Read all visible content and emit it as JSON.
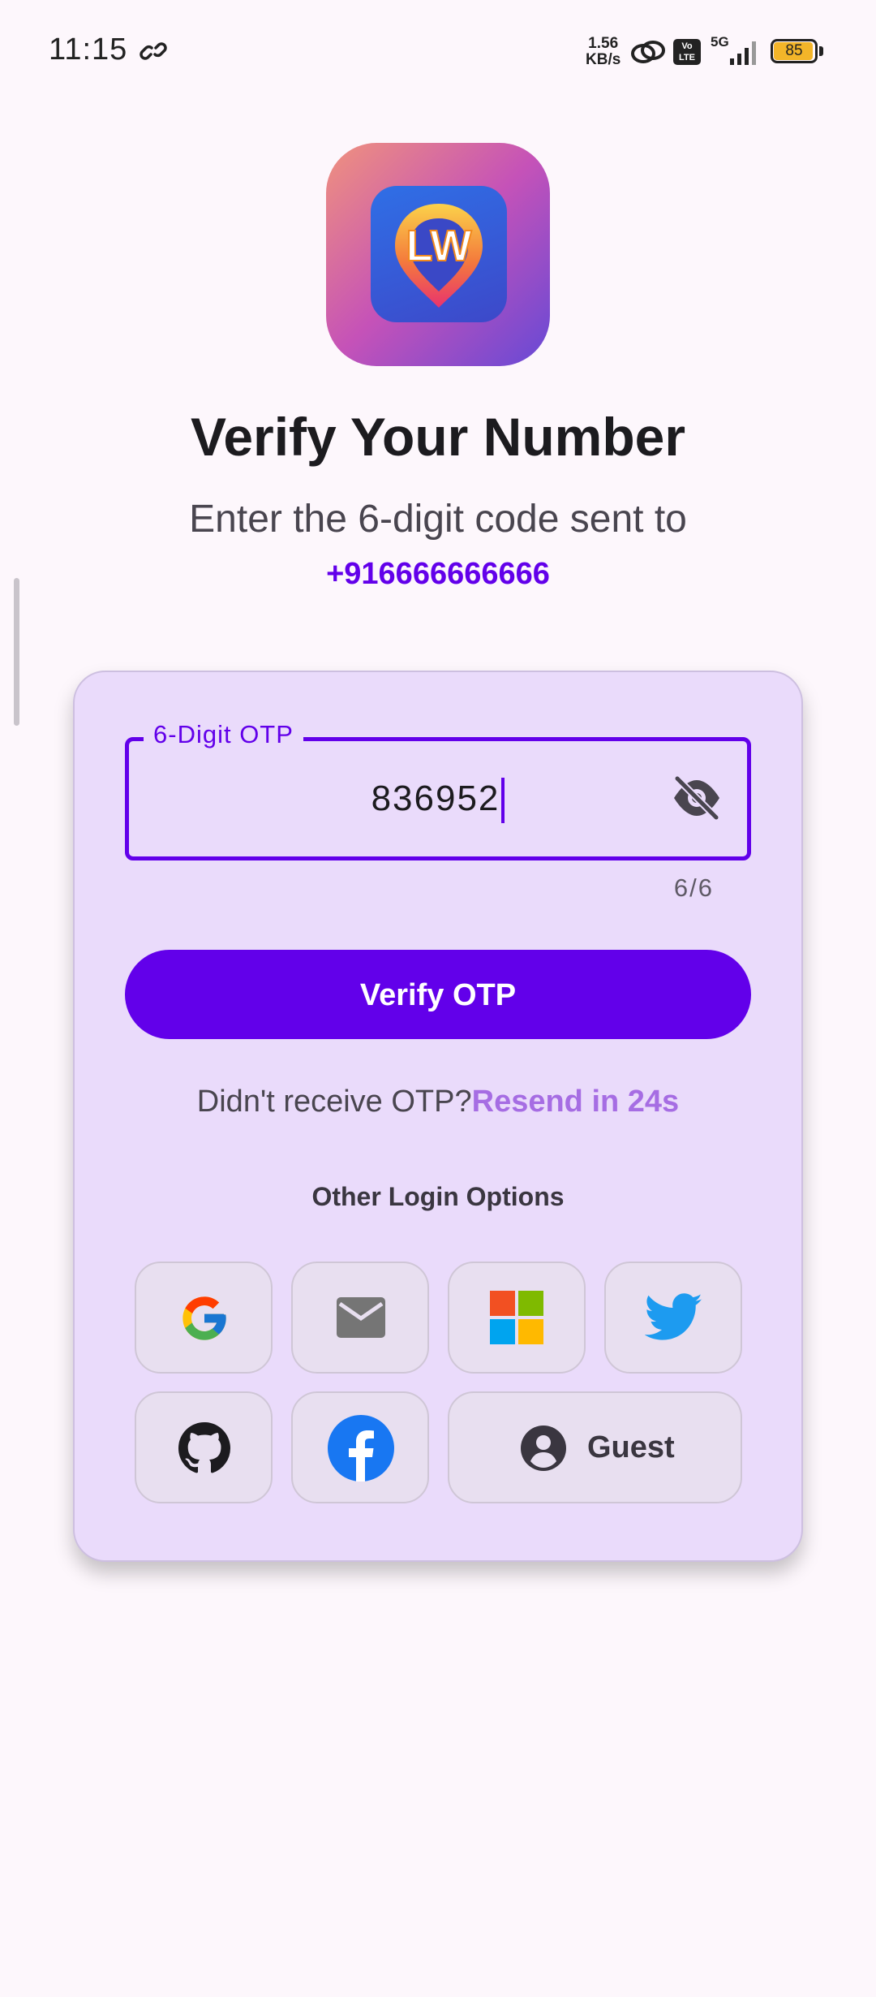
{
  "status_bar": {
    "time": "11:15",
    "net_speed_value": "1.56",
    "net_speed_unit": "KB/s",
    "volte_label": "Vo LTE",
    "network_label": "5G",
    "battery_level": "85",
    "battery_color": "#f3b529"
  },
  "header": {
    "logo_text": "LW",
    "title": "Verify Your Number",
    "subtitle": "Enter the 6-digit code sent to",
    "phone_number": "+916666666666"
  },
  "otp": {
    "label": "6-Digit OTP",
    "value": "836952",
    "counter": "6/6",
    "visibility_icon": "visibility-off-icon"
  },
  "actions": {
    "verify_label": "Verify OTP",
    "resend_prompt": "Didn't receive OTP?",
    "resend_link": "Resend in 24s"
  },
  "other_login": {
    "heading": "Other Login Options",
    "options": [
      {
        "name": "google",
        "icon": "google-icon"
      },
      {
        "name": "email",
        "icon": "email-icon"
      },
      {
        "name": "microsoft",
        "icon": "microsoft-icon"
      },
      {
        "name": "twitter",
        "icon": "twitter-icon"
      },
      {
        "name": "github",
        "icon": "github-icon"
      },
      {
        "name": "facebook",
        "icon": "facebook-icon"
      },
      {
        "name": "guest",
        "icon": "account-circle-icon",
        "label": "Guest"
      }
    ]
  },
  "colors": {
    "primary": "#6200ea",
    "card_background": "#eadbfb",
    "page_background": "#fdf7fc",
    "resend_link": "#a66de3"
  }
}
